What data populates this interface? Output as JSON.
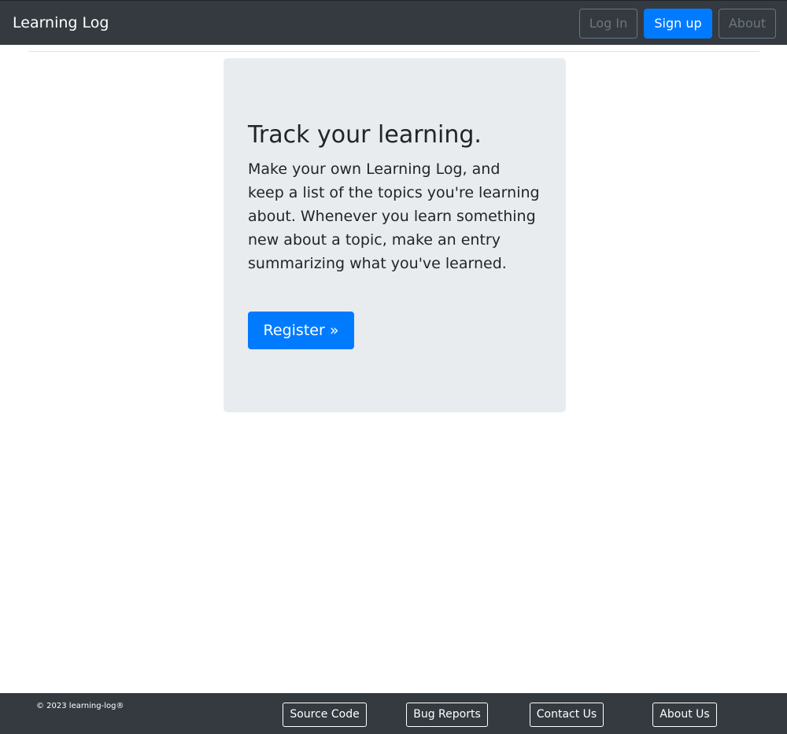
{
  "navbar": {
    "brand": "Learning Log",
    "login_label": "Log In",
    "signup_label": "Sign up",
    "about_label": "About"
  },
  "hero": {
    "title": "Track your learning.",
    "text": "Make your own Learning Log, and keep a list of the topics you're learning about. Whenever you learn something new about a topic, make an entry summarizing what you've learned.",
    "register_label": "Register »"
  },
  "footer": {
    "copyright": "© 2023 learning-log®",
    "links": {
      "source_code": "Source Code",
      "bug_reports": "Bug Reports",
      "contact_us": "Contact Us",
      "about_us": "About Us"
    }
  },
  "colors": {
    "navbar_bg": "#343a40",
    "primary": "#007bff",
    "jumbotron_bg": "#e9ecef",
    "muted_outline": "#6c757d"
  }
}
